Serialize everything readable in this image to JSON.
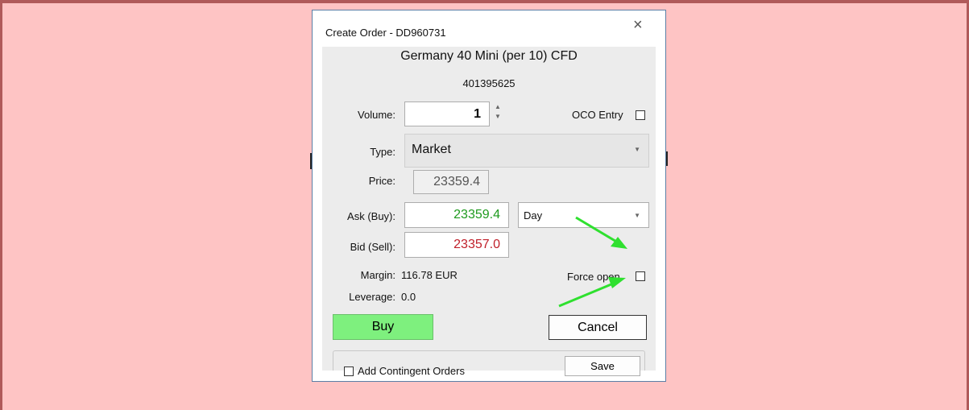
{
  "dialog": {
    "title": "Create Order - DD960731",
    "close_symbol": "×",
    "instrument": "Germany 40 Mini (per 10) CFD",
    "instrument_id": "401395625"
  },
  "volume": {
    "label": "Volume:",
    "value": "1"
  },
  "oco": {
    "label": "OCO Entry"
  },
  "type": {
    "label": "Type:",
    "value": "Market"
  },
  "price": {
    "label": "Price:",
    "value": "23359.4"
  },
  "ask": {
    "label": "Ask (Buy):",
    "value": "23359.4",
    "color": "#1e9a1e"
  },
  "bid": {
    "label": "Bid (Sell):",
    "value": "23357.0",
    "color": "#c0202a"
  },
  "duration": {
    "value": "Day"
  },
  "margin": {
    "label": "Margin:",
    "value": "116.78 EUR"
  },
  "leverage": {
    "label": "Leverage:",
    "value": "0.0"
  },
  "force_open": {
    "label": "Force open"
  },
  "buttons": {
    "buy": "Buy",
    "cancel": "Cancel",
    "save": "Save"
  },
  "contingent": {
    "label": "Add Contingent Orders"
  },
  "colors": {
    "backdrop": "#fec4c4",
    "buy_button": "#7ef07e",
    "annotation_arrow": "#2fe02f"
  }
}
